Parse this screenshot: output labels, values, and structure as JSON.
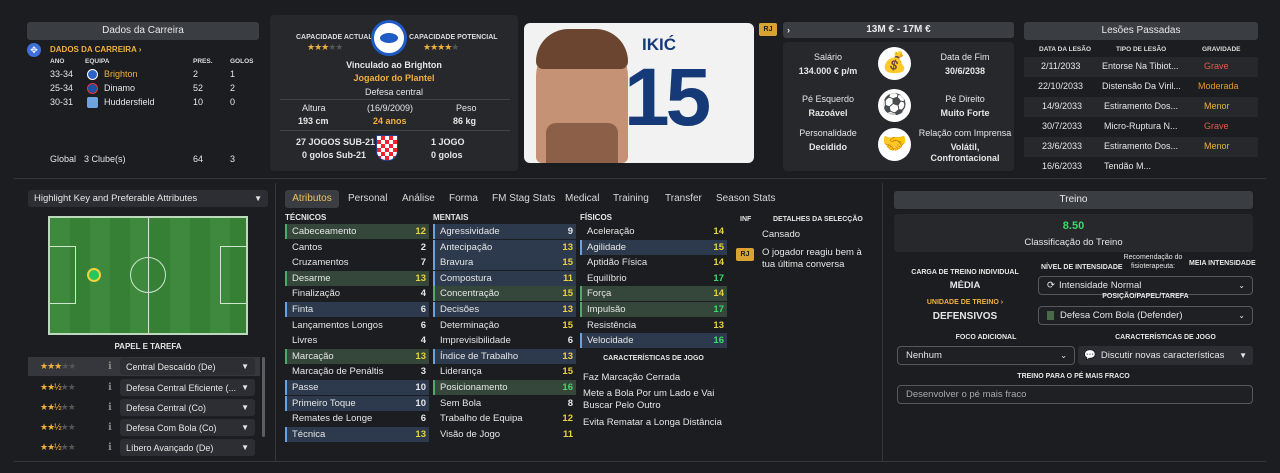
{
  "career": {
    "header": "Dados da Carreira",
    "link": "DADOS DA CARREIRA",
    "cols": [
      "ANO",
      "EQUIPA",
      "PRES.",
      "GOLOS"
    ],
    "rows": [
      {
        "year": "33-34",
        "team": "Brighton",
        "apps": "2",
        "goals": "1"
      },
      {
        "year": "25-34",
        "team": "Dinamo",
        "apps": "52",
        "goals": "2"
      },
      {
        "year": "30-31",
        "team": "Huddersfield",
        "apps": "10",
        "goals": "0"
      }
    ],
    "total": {
      "label": "Global",
      "clubs": "3 Clube(s)",
      "apps": "64",
      "goals": "3"
    }
  },
  "profile": {
    "cap_actual": "CAPACIDADE ACTUAL",
    "cap_potencial": "CAPACIDADE POTENCIAL",
    "actual_stars": "★★★",
    "actual_empty": "★★",
    "pot_stars": "★★★★",
    "pot_empty": "★",
    "contract": "Vinculado ao Brighton",
    "squad": "Jogador do Plantel",
    "position": "Defesa central",
    "height_label": "Altura",
    "height": "193 cm",
    "dob": "(16/9/2009)",
    "age": "24 anos",
    "weight_label": "Peso",
    "weight": "86 kg",
    "u21_games": "27 JOGOS SUB-21",
    "u21_goals": "0 golos Sub-21",
    "intl_games": "1 JOGO",
    "intl_goals": "0 golos"
  },
  "player": {
    "name": "IKIĆ",
    "number": "15"
  },
  "value": {
    "rj": "RJ",
    "range": "13M € - 17M €",
    "salary_label": "Salário",
    "salary": "134.000 € p/m",
    "end_label": "Data de Fim",
    "end": "30/6/2038",
    "left_label": "Pé Esquerdo",
    "left": "Razoável",
    "right_label": "Pé Direito",
    "right": "Muito Forte",
    "pers_label": "Personalidade",
    "pers": "Decidido",
    "media_label": "Relação com Imprensa",
    "media": "Volátil, Confrontacional"
  },
  "injuries": {
    "header": "Lesões Passadas",
    "cols": [
      "DATA DA LESÃO",
      "TIPO DE LESÃO",
      "GRAVIDADE"
    ],
    "rows": [
      {
        "date": "2/11/2033",
        "type": "Entorse Na Tibiot...",
        "sev": "Grave",
        "c": "#e45b4b"
      },
      {
        "date": "22/10/2033",
        "type": "Distensão Da Viril...",
        "sev": "Moderada",
        "c": "#e8972e"
      },
      {
        "date": "14/9/2033",
        "type": "Estiramento Dos...",
        "sev": "Menor",
        "c": "#e8b43d"
      },
      {
        "date": "30/7/2033",
        "type": "Micro-Ruptura N...",
        "sev": "Grave",
        "c": "#e45b4b"
      },
      {
        "date": "23/6/2033",
        "type": "Estiramento Dos...",
        "sev": "Menor",
        "c": "#e8b43d"
      },
      {
        "date": "16/6/2033",
        "type": "Tendão M...",
        "sev": "",
        "c": "#e8b43d"
      }
    ]
  },
  "left": {
    "dropdown": "Highlight Key and Preferable Attributes",
    "roles_title": "PAPEL E TAREFA",
    "roles": [
      {
        "stars": "★★★",
        "empty": "★★",
        "name": "Central Descaído (De)"
      },
      {
        "stars": "★★½",
        "empty": "★★",
        "name": "Defesa Central Eficiente (..."
      },
      {
        "stars": "★★½",
        "empty": "★★",
        "name": "Defesa Central (Co)"
      },
      {
        "stars": "★★½",
        "empty": "★★",
        "name": "Defesa Com Bola (Co)"
      },
      {
        "stars": "★★½",
        "empty": "★★",
        "name": "Líbero Avançado (De)"
      }
    ]
  },
  "tabs": [
    "Atributos",
    "Personal",
    "Análise",
    "Forma",
    "FM Stag Stats",
    "Medical",
    "Training",
    "Transfer",
    "Season Stats"
  ],
  "attributes": {
    "tech_title": "TÉCNICOS",
    "ment_title": "MENTAIS",
    "phys_title": "FÍSICOS",
    "tech": [
      [
        "Cabeceamento",
        "12"
      ],
      [
        "Cantos",
        "2"
      ],
      [
        "Cruzamentos",
        "7"
      ],
      [
        "Desarme",
        "13"
      ],
      [
        "Finalização",
        "4"
      ],
      [
        "Finta",
        "6"
      ],
      [
        "Lançamentos Longos",
        "6"
      ],
      [
        "Livres",
        "4"
      ],
      [
        "Marcação",
        "13"
      ],
      [
        "Marcação de Penáltis",
        "3"
      ],
      [
        "Passe",
        "10"
      ],
      [
        "Primeiro Toque",
        "10"
      ],
      [
        "Remates de Longe",
        "6"
      ],
      [
        "Técnica",
        "13"
      ]
    ],
    "ment": [
      [
        "Agressividade",
        "9"
      ],
      [
        "Antecipação",
        "13"
      ],
      [
        "Bravura",
        "15"
      ],
      [
        "Compostura",
        "11"
      ],
      [
        "Concentração",
        "15"
      ],
      [
        "Decisões",
        "13"
      ],
      [
        "Determinação",
        "15"
      ],
      [
        "Imprevisibilidade",
        "6"
      ],
      [
        "Índice de Trabalho",
        "13"
      ],
      [
        "Liderança",
        "15"
      ],
      [
        "Posicionamento",
        "16"
      ],
      [
        "Sem Bola",
        "8"
      ],
      [
        "Trabalho de Equipa",
        "12"
      ],
      [
        "Visão de Jogo",
        "11"
      ]
    ],
    "phys": [
      [
        "Aceleração",
        "14"
      ],
      [
        "Agilidade",
        "15"
      ],
      [
        "Aptidão Física",
        "14"
      ],
      [
        "Equilíbrio",
        "17"
      ],
      [
        "Força",
        "14"
      ],
      [
        "Impulsão",
        "17"
      ],
      [
        "Resistência",
        "13"
      ],
      [
        "Velocidade",
        "16"
      ]
    ],
    "traits_title": "CARACTERÍSTICAS DE JOGO",
    "traits": [
      "Faz Marcação Cerrada",
      "Mete a Bola Por um Lado e Vai Buscar Pelo Outro",
      "Evita Rematar a Longa Distância"
    ]
  },
  "info": {
    "inf": "INF",
    "details": "DETALHES DA SELECÇÃO",
    "tired": "Cansado",
    "rj": "RJ",
    "note": "O jogador reagiu bem à tua última conversa"
  },
  "training": {
    "header": "Treino",
    "rating": "8.50",
    "rating_label": "Classificação do Treino",
    "load_label": "CARGA DE TREINO INDIVIDUAL",
    "load": "MÉDIA",
    "intensity_label": "NÍVEL DE INTENSIDADE",
    "physio_label": "Recomendação do fisioterapeuta:",
    "physio": "MEIA INTENSIDADE",
    "intensity": "Intensidade Normal",
    "unit_label": "UNIDADE DE TREINO",
    "unit": "DEFENSIVOS",
    "role_label": "POSIÇÃO/PAPEL/TAREFA",
    "role": "Defesa Com Bola (Defender)",
    "focus_label": "FOCO ADICIONAL",
    "focus": "Nenhum",
    "traits_label": "CARACTERÍSTICAS DE JOGO",
    "traits": "Discutir novas características",
    "weak_label": "TREINO PARA O PÉ MAIS FRACO",
    "weak": "Desenvolver o pé mais fraco"
  }
}
